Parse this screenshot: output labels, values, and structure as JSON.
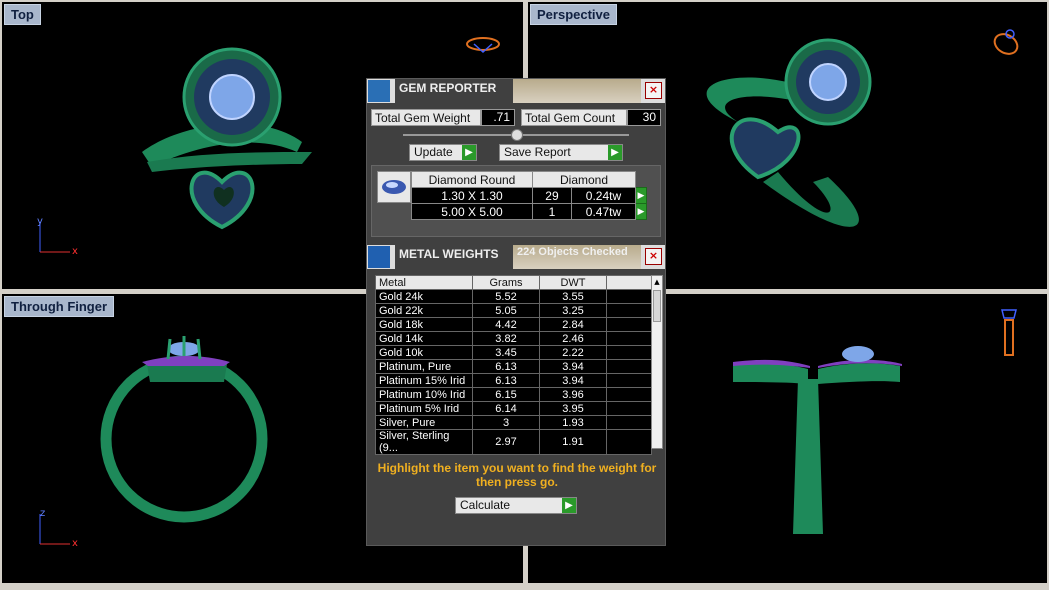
{
  "viewports": {
    "top": "Top",
    "perspective": "Perspective",
    "through_finger": "Through Finger"
  },
  "axes": {
    "x": "x",
    "y": "y",
    "z": "z"
  },
  "gem_reporter": {
    "title": "GEM REPORTER",
    "close": "×",
    "total_weight_label": "Total Gem Weight",
    "total_weight_value": ".71",
    "total_count_label": "Total Gem Count",
    "total_count_value": "30",
    "update_label": "Update",
    "save_report_label": "Save Report",
    "table": {
      "headers": [
        "Diamond Round",
        "Diamond"
      ],
      "rows": [
        {
          "size": "1.30 X 1.30",
          "count": "29",
          "weight": "0.24tw"
        },
        {
          "size": "5.00 X 5.00",
          "count": "1",
          "weight": "0.47tw"
        }
      ]
    }
  },
  "metal_weights": {
    "title": "METAL WEIGHTS",
    "objects_checked": "224 Objects Checked",
    "close": "×",
    "headers": [
      "Metal",
      "Grams",
      "DWT"
    ],
    "rows": [
      {
        "metal": "Gold 24k",
        "grams": "5.52",
        "dwt": "3.55"
      },
      {
        "metal": "Gold 22k",
        "grams": "5.05",
        "dwt": "3.25"
      },
      {
        "metal": "Gold 18k",
        "grams": "4.42",
        "dwt": "2.84"
      },
      {
        "metal": "Gold 14k",
        "grams": "3.82",
        "dwt": "2.46"
      },
      {
        "metal": "Gold 10k",
        "grams": "3.45",
        "dwt": "2.22"
      },
      {
        "metal": "Platinum, Pure",
        "grams": "6.13",
        "dwt": "3.94"
      },
      {
        "metal": "Platinum 15% Irid",
        "grams": "6.13",
        "dwt": "3.94"
      },
      {
        "metal": "Platinum 10% Irid",
        "grams": "6.15",
        "dwt": "3.96"
      },
      {
        "metal": "Platinum 5% Irid",
        "grams": "6.14",
        "dwt": "3.95"
      },
      {
        "metal": "Silver, Pure",
        "grams": "3",
        "dwt": "1.93"
      },
      {
        "metal": "Silver, Sterling (9...",
        "grams": "2.97",
        "dwt": "1.91"
      }
    ],
    "hint": "Highlight the item you want to find the weight for then press go.",
    "calculate_label": "Calculate"
  }
}
